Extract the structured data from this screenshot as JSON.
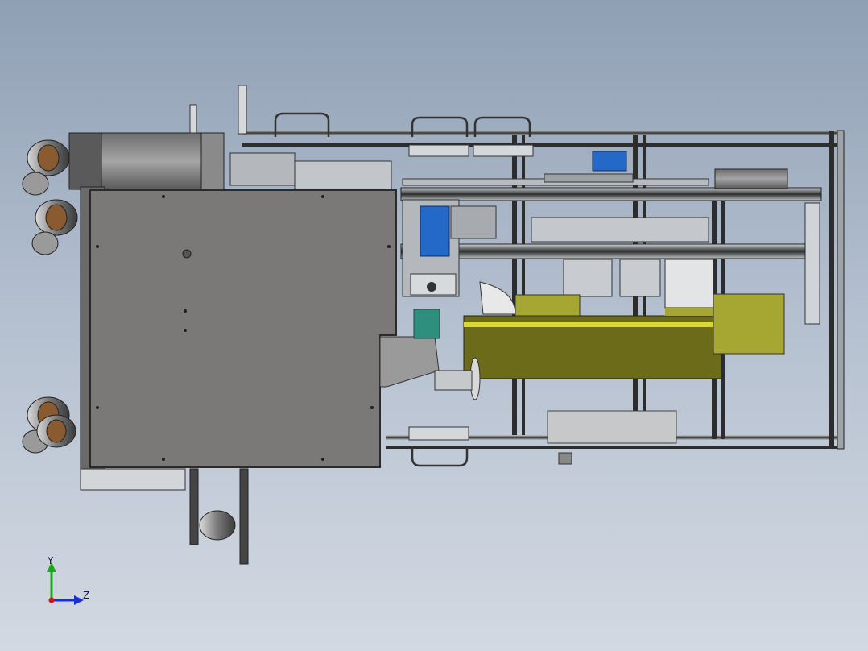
{
  "window": {
    "background_top": "#8f9fb4",
    "background_bottom": "#d3d9e2"
  },
  "model": {
    "colors": {
      "frame": "#3a3a3a",
      "frame_light": "#9ea3a8",
      "panel": "#7b7977",
      "panel_edge": "#2b2b2b",
      "yellow_plate": "#6b6b1a",
      "yellow_stripe": "#d8d830",
      "yellow_tab": "#a6a632",
      "cylinder_blue": "#2468c8",
      "motor_teal": "#2f8f7f",
      "wheel": "#8a8a8a"
    },
    "icons": [
      "caster-wheel-icon",
      "handle-icon",
      "blue-cylinder-icon",
      "servo-motor-icon"
    ]
  },
  "triad": {
    "y_label": "Y",
    "z_label": "Z",
    "y_color": "#18a818",
    "z_color": "#1830d8",
    "origin_color": "#c81818"
  }
}
